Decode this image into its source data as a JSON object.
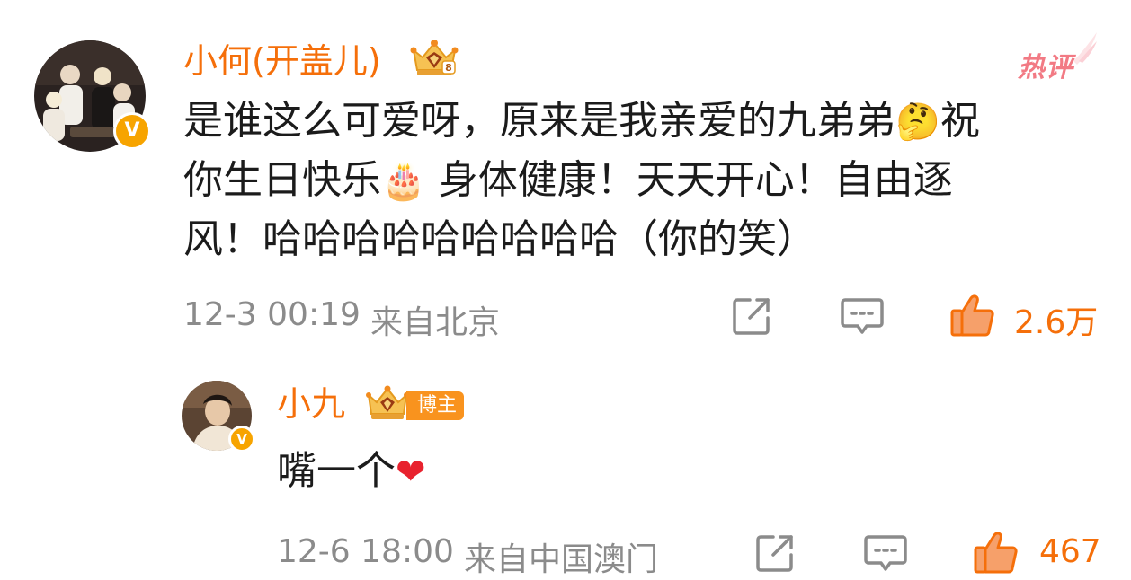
{
  "comment": {
    "username": "小何(开盖儿)",
    "hot_label": "热评",
    "text_lines": [
      "是谁这么可爱呀，原来是我亲爱的九弟弟",
      "祝",
      "你生日快乐",
      " 身体健康！天天开心！自由逐",
      "风！哈哈哈哈哈哈哈哈哈（你的笑）"
    ],
    "emoji_smirk": "🤔",
    "emoji_cake": "🎂",
    "timestamp": "12-3 00:19",
    "location": "来自北京",
    "like_count": "2.6万"
  },
  "reply": {
    "username": "小九",
    "role_badge": "博主",
    "text": "嘴一个",
    "heart": "❤",
    "timestamp": "12-6 18:00",
    "location": "来自中国澳门",
    "like_count": "467"
  },
  "badge_letter": "V",
  "colors": {
    "username": "#f56f0a",
    "like_active": "#f56f0a",
    "meta": "#8b8b8b",
    "hot": "#f27a84",
    "verify_badge": "#f7a400"
  },
  "icons": {
    "share": "share-icon",
    "comment": "comment-icon",
    "like": "thumbs-up-icon"
  }
}
